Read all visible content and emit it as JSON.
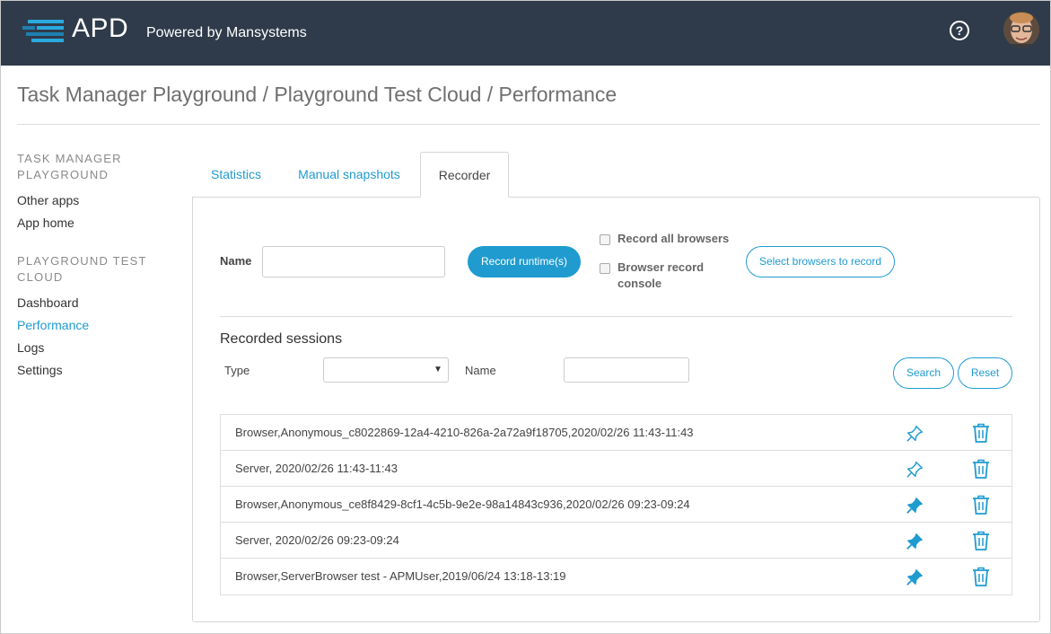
{
  "header": {
    "logo_text": "APD",
    "powered_by": "Powered by Mansystems",
    "help_icon": "question-circle-icon",
    "colors": {
      "bar": "#2f3b4a",
      "accent": "#1f9bcf"
    }
  },
  "breadcrumb": "Task Manager Playground / Playground Test Cloud / Performance",
  "sidebar": {
    "group1_heading": "TASK MANAGER PLAYGROUND",
    "group1_items": [
      "Other apps",
      "App home"
    ],
    "group2_heading": "PLAYGROUND TEST CLOUD",
    "group2_items": [
      "Dashboard",
      "Performance",
      "Logs",
      "Settings"
    ],
    "active_item": "Performance"
  },
  "tabs": [
    {
      "label": "Statistics",
      "active": false
    },
    {
      "label": "Manual snapshots",
      "active": false
    },
    {
      "label": "Recorder",
      "active": true
    }
  ],
  "recorder": {
    "name_label": "Name",
    "name_value": "",
    "record_button": "Record runtime(s)",
    "record_all_browsers": "Record all browsers",
    "browser_record_console_line1": "Browser record",
    "browser_record_console_line2": "console",
    "select_browsers_button": "Select browsers to record"
  },
  "sessions": {
    "title": "Recorded sessions",
    "type_label": "Type",
    "type_value": "",
    "name_label": "Name",
    "name_value": "",
    "search_button": "Search",
    "reset_button": "Reset",
    "rows": [
      {
        "text": "Browser,Anonymous_c8022869-12a4-4210-826a-2a72a9f18705,2020/02/26 11:43-11:43",
        "pinned": false
      },
      {
        "text": "Server, 2020/02/26 11:43-11:43",
        "pinned": false
      },
      {
        "text": "Browser,Anonymous_ce8f8429-8cf1-4c5b-9e2e-98a14843c936,2020/02/26 09:23-09:24",
        "pinned": true
      },
      {
        "text": "Server, 2020/02/26 09:23-09:24",
        "pinned": true
      },
      {
        "text": "Browser,ServerBrowser test - APMUser,2019/06/24 13:18-13:19",
        "pinned": true
      }
    ]
  }
}
